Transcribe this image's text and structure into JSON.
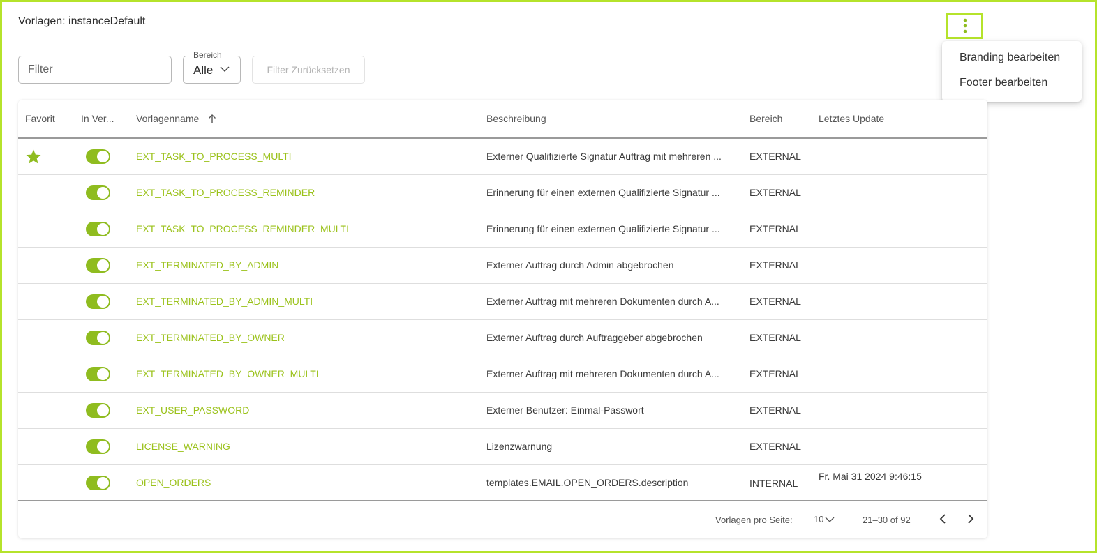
{
  "page": {
    "title": "Vorlagen: instanceDefault"
  },
  "menu": {
    "icon": "more-vert-icon",
    "items": [
      {
        "label": "Branding bearbeiten"
      },
      {
        "label": "Footer bearbeiten"
      }
    ]
  },
  "filter": {
    "placeholder": "Filter",
    "value": "",
    "scope_label": "Bereich",
    "scope_value": "Alle",
    "reset_label": "Filter Zurücksetzen"
  },
  "table": {
    "headers": {
      "favorite": "Favorit",
      "in_use": "In Ver...",
      "name": "Vorlagenname",
      "description": "Beschreibung",
      "scope": "Bereich",
      "updated": "Letztes Update"
    },
    "sort": {
      "column": "Vorlagenname",
      "direction": "ascending"
    },
    "rows": [
      {
        "favorite": true,
        "enabled": true,
        "name": "EXT_TASK_TO_PROCESS_MULTI",
        "description": "Externer Qualifizierte Signatur Auftrag mit mehreren ...",
        "scope": "EXTERNAL",
        "updated": ""
      },
      {
        "favorite": false,
        "enabled": true,
        "name": "EXT_TASK_TO_PROCESS_REMINDER",
        "description": "Erinnerung für einen externen Qualifizierte Signatur ...",
        "scope": "EXTERNAL",
        "updated": ""
      },
      {
        "favorite": false,
        "enabled": true,
        "name": "EXT_TASK_TO_PROCESS_REMINDER_MULTI",
        "description": "Erinnerung für einen externen Qualifizierte Signatur ...",
        "scope": "EXTERNAL",
        "updated": ""
      },
      {
        "favorite": false,
        "enabled": true,
        "name": "EXT_TERMINATED_BY_ADMIN",
        "description": "Externer Auftrag durch Admin abgebrochen",
        "scope": "EXTERNAL",
        "updated": ""
      },
      {
        "favorite": false,
        "enabled": true,
        "name": "EXT_TERMINATED_BY_ADMIN_MULTI",
        "description": "Externer Auftrag mit mehreren Dokumenten durch A...",
        "scope": "EXTERNAL",
        "updated": ""
      },
      {
        "favorite": false,
        "enabled": true,
        "name": "EXT_TERMINATED_BY_OWNER",
        "description": "Externer Auftrag durch Auftraggeber abgebrochen",
        "scope": "EXTERNAL",
        "updated": ""
      },
      {
        "favorite": false,
        "enabled": true,
        "name": "EXT_TERMINATED_BY_OWNER_MULTI",
        "description": "Externer Auftrag mit mehreren Dokumenten durch A...",
        "scope": "EXTERNAL",
        "updated": ""
      },
      {
        "favorite": false,
        "enabled": true,
        "name": "EXT_USER_PASSWORD",
        "description": "Externer Benutzer: Einmal-Passwort",
        "scope": "EXTERNAL",
        "updated": ""
      },
      {
        "favorite": false,
        "enabled": true,
        "name": "LICENSE_WARNING",
        "description": "Lizenzwarnung",
        "scope": "EXTERNAL",
        "updated": ""
      },
      {
        "favorite": false,
        "enabled": true,
        "name": "OPEN_ORDERS",
        "description": "templates.EMAIL.OPEN_ORDERS.description",
        "scope": "INTERNAL",
        "updated": "Fr. Mai 31 2024 9:46:15"
      }
    ]
  },
  "pagination": {
    "per_page_label": "Vorlagen pro Seite:",
    "per_page_value": "10",
    "range": "21–30 of 92"
  },
  "colors": {
    "accent": "#b5e32b",
    "link": "#9bc21b",
    "toggle_on": "#8fbc1f",
    "star": "#8fbc1f"
  }
}
